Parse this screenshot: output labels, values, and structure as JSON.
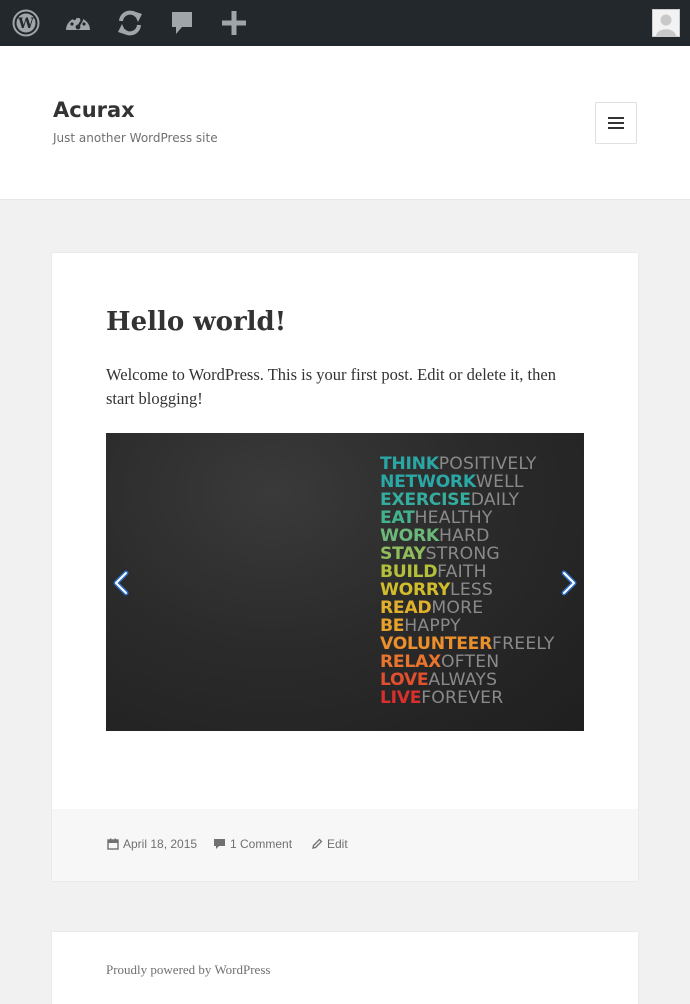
{
  "adminbar": {
    "icons": [
      "wordpress-logo-icon",
      "dashboard-icon",
      "updates-icon",
      "comments-icon",
      "new-content-icon"
    ],
    "avatar": "user-avatar"
  },
  "site": {
    "title": "Acurax",
    "description": "Just another WordPress site",
    "menu_icon": "hamburger-icon"
  },
  "post": {
    "title": "Hello world!",
    "body": "Welcome to WordPress. This is your first post. Edit or delete it, then start blogging!",
    "image_words": [
      {
        "bold": "THINK",
        "thin": "POSITIVELY",
        "color": "#2aa6a5"
      },
      {
        "bold": "NETWORK",
        "thin": "WELL",
        "color": "#2aa8a6"
      },
      {
        "bold": "EXERCISE",
        "thin": "DAILY",
        "color": "#35ad9e"
      },
      {
        "bold": "EAT",
        "thin": "HEALTHY",
        "color": "#42b38f"
      },
      {
        "bold": "WORK",
        "thin": "HARD",
        "color": "#6ab97a"
      },
      {
        "bold": "STAY",
        "thin": "STRONG",
        "color": "#8fbd5c"
      },
      {
        "bold": "BUILD",
        "thin": "FAITH",
        "color": "#b5c03a"
      },
      {
        "bold": "WORRY",
        "thin": "LESS",
        "color": "#d1bd2c"
      },
      {
        "bold": "READ",
        "thin": "MORE",
        "color": "#e2b02a"
      },
      {
        "bold": "BE",
        "thin": "HAPPY",
        "color": "#e8a12b"
      },
      {
        "bold": "VOLUNTEER",
        "thin": "FREELY",
        "color": "#ea8f2c"
      },
      {
        "bold": "RELAX",
        "thin": "OFTEN",
        "color": "#e8742d"
      },
      {
        "bold": "LOVE",
        "thin": "ALWAYS",
        "color": "#e2502d"
      },
      {
        "bold": "LIVE",
        "thin": "FOREVER",
        "color": "#d9302e"
      }
    ],
    "meta": {
      "date": "April 18, 2015",
      "comments": "1 Comment",
      "edit": "Edit"
    }
  },
  "footer": {
    "text": "Proudly powered by WordPress"
  }
}
